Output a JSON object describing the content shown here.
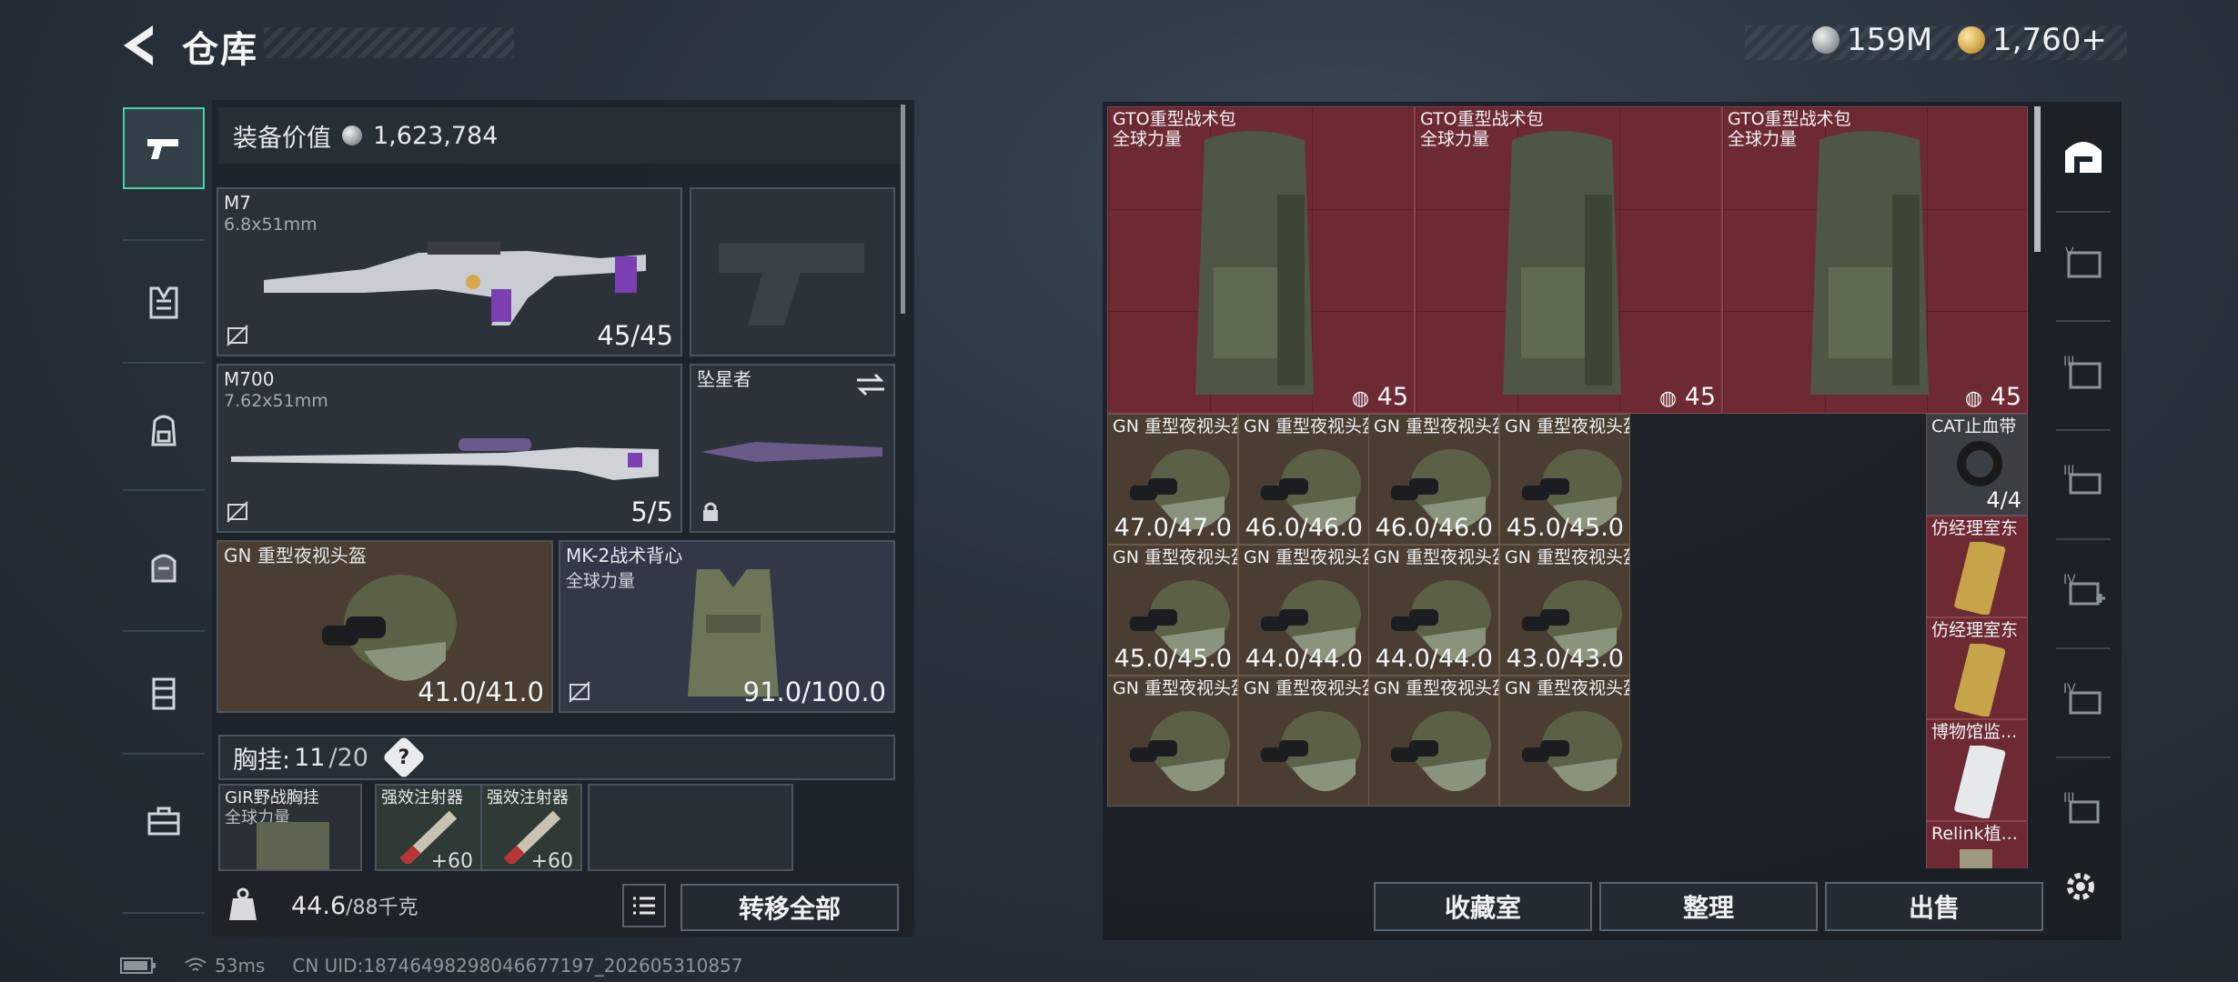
{
  "header": {
    "title": "仓库",
    "currency_silver": "159M",
    "currency_gold": "1,760+"
  },
  "left_tabs": [
    "pistol-icon",
    "vest-icon",
    "backpack-icon",
    "bag-icon",
    "locker-icon",
    "toolbox-icon"
  ],
  "equipment": {
    "value_label": "装备价值",
    "value": "1,623,784",
    "slots": [
      {
        "name": "M7",
        "sub": "6.8x51mm",
        "value": "45/45"
      },
      {
        "name": "",
        "sub": "",
        "value": ""
      },
      {
        "name": "M700",
        "sub": "7.62x51mm",
        "value": "5/5"
      },
      {
        "name": "坠星者",
        "sub": "",
        "value": ""
      },
      {
        "name": "GN 重型夜视头盔",
        "sub": "",
        "value": "41.0/41.0"
      },
      {
        "name": "MK-2战术背心",
        "sub": "全球力量",
        "value": "91.0/100.0"
      }
    ],
    "chest_label": "胸挂:",
    "chest_used": "11",
    "chest_total": "/20",
    "chest_help": "?",
    "chest_items": [
      {
        "name": "GIR野战胸挂",
        "sub": "全球力量",
        "value": ""
      },
      {
        "name": "强效注射器",
        "value": "+60"
      },
      {
        "name": "强效注射器",
        "value": "+60"
      }
    ]
  },
  "weight": {
    "current": "44.6",
    "max": "/88千克"
  },
  "buttons": {
    "transfer_all": "转移全部",
    "collection": "收藏室",
    "organize": "整理",
    "sell": "出售"
  },
  "stash": {
    "backpacks": [
      {
        "name": "GTO重型战术包",
        "sub": "全球力量",
        "value": "45"
      },
      {
        "name": "GTO重型战术包",
        "sub": "全球力量",
        "value": "45"
      },
      {
        "name": "GTO重型战术包",
        "sub": "全球力量",
        "value": "45"
      }
    ],
    "helmets_row1": [
      {
        "name": "GN 重型夜视头盔",
        "value": "47.0/47.0"
      },
      {
        "name": "GN 重型夜视头盔",
        "value": "46.0/46.0"
      },
      {
        "name": "GN 重型夜视头盔",
        "value": "46.0/46.0"
      },
      {
        "name": "GN 重型夜视头盔",
        "value": "45.0/45.0"
      }
    ],
    "helmets_row2": [
      {
        "name": "GN 重型夜视头盔",
        "value": "45.0/45.0"
      },
      {
        "name": "GN 重型夜视头盔",
        "value": "44.0/44.0"
      },
      {
        "name": "GN 重型夜视头盔",
        "value": "44.0/44.0"
      },
      {
        "name": "GN 重型夜视头盔",
        "value": "43.0/43.0"
      }
    ],
    "helmets_row3": [
      {
        "name": "GN 重型夜视头盔"
      },
      {
        "name": "GN 重型夜视头盔"
      },
      {
        "name": "GN 重型夜视头盔"
      },
      {
        "name": "GN 重型夜视头盔"
      }
    ],
    "side": [
      {
        "name": "CAT止血带",
        "value": "4/4"
      },
      {
        "name": "仿经理室东"
      },
      {
        "name": "仿经理室东"
      },
      {
        "name": "博物馆监..."
      },
      {
        "name": "Relink植..."
      }
    ]
  },
  "footer": {
    "ping": "53ms",
    "uid": "CN UID:18746498298046677197_202605310857"
  }
}
